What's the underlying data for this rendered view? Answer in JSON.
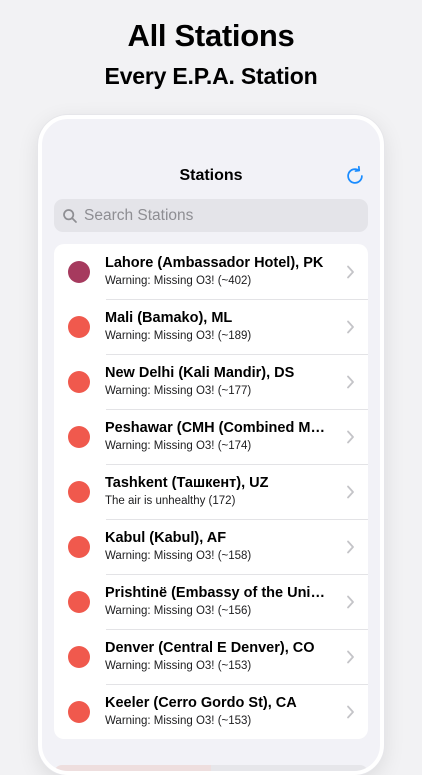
{
  "hero": {
    "title": "All Stations",
    "subtitle": "Every E.P.A. Station"
  },
  "nav": {
    "title": "Stations",
    "refresh_icon": "refresh-icon",
    "accent_color": "#1a8cff"
  },
  "search": {
    "placeholder": "Search Stations",
    "value": "",
    "icon": "search-icon"
  },
  "stations": [
    {
      "name": "Lahore (Ambassador Hotel), PK",
      "status": "Warning: Missing O3! (~402)",
      "color": "#a63a5e"
    },
    {
      "name": "Mali (Bamako), ML",
      "status": "Warning: Missing O3! (~189)",
      "color": "#f0594d"
    },
    {
      "name": "New Delhi (Kali Mandir), DS",
      "status": "Warning: Missing O3! (~177)",
      "color": "#f0594d"
    },
    {
      "name": "Peshawar (CMH (Combined Mili...",
      "status": "Warning: Missing O3! (~174)",
      "color": "#f0594d"
    },
    {
      "name": "Tashkent (Ташкент), UZ",
      "status": "The air is unhealthy (172)",
      "color": "#f0594d"
    },
    {
      "name": "Kabul (Kabul), AF",
      "status": "Warning: Missing O3! (~158)",
      "color": "#f0594d"
    },
    {
      "name": "Prishtinë (Embassy of the Unite...",
      "status": "Warning: Missing O3! (~156)",
      "color": "#f0594d"
    },
    {
      "name": "Denver (Central E Denver), CO",
      "status": "Warning: Missing O3! (~153)",
      "color": "#f0594d"
    },
    {
      "name": "Keeler (Cerro Gordo St), CA",
      "status": "Warning: Missing O3! (~153)",
      "color": "#f0594d"
    }
  ]
}
